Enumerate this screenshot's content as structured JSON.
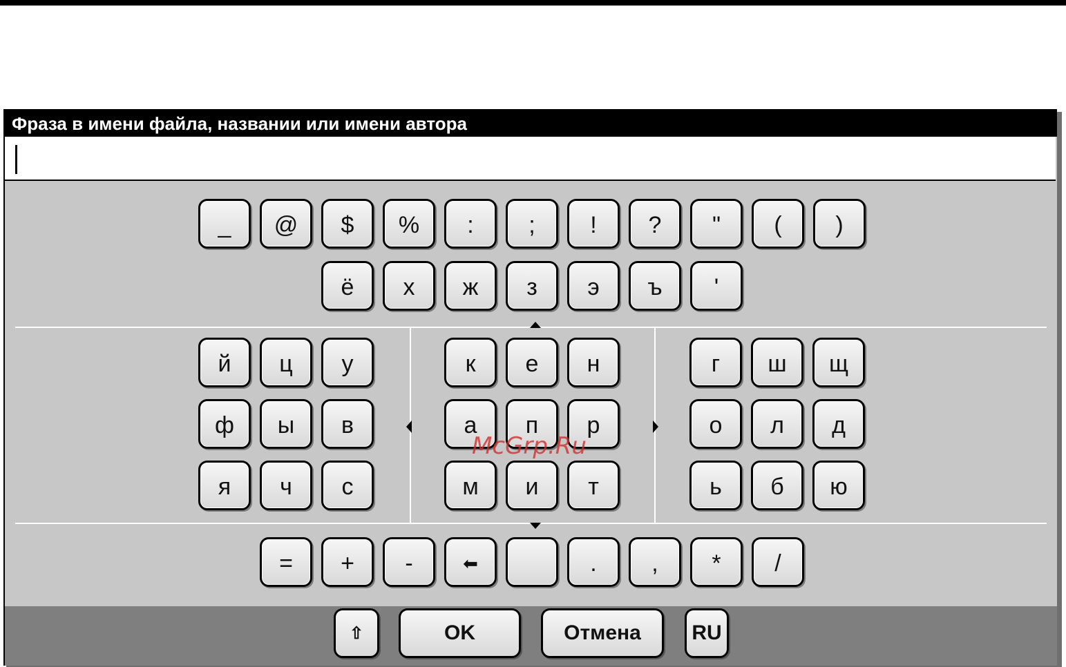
{
  "dialog": {
    "title": "Фраза в имени файла, названии или имени автора",
    "input_value": ""
  },
  "keyboard": {
    "symbols_row": [
      "_",
      "@",
      "$",
      "%",
      ":",
      ";",
      "!",
      "?",
      "\"",
      "(",
      ")"
    ],
    "extra_letters_row": [
      "ё",
      "х",
      "ж",
      "з",
      "э",
      "ъ",
      "'"
    ],
    "left_block": [
      [
        "й",
        "ц",
        "у"
      ],
      [
        "ф",
        "ы",
        "в"
      ],
      [
        "я",
        "ч",
        "с"
      ]
    ],
    "center_block": [
      [
        "к",
        "е",
        "н"
      ],
      [
        "а",
        "п",
        "р"
      ],
      [
        "м",
        "и",
        "т"
      ]
    ],
    "right_block": [
      [
        "г",
        "ш",
        "щ"
      ],
      [
        "о",
        "л",
        "д"
      ],
      [
        "ь",
        "б",
        "ю"
      ]
    ],
    "bottom_row": [
      "=",
      "+",
      "-",
      "⬅",
      " ",
      ".",
      ",",
      "*",
      "/"
    ]
  },
  "buttons": {
    "shift_icon": "⇧",
    "ok_label": "OK",
    "cancel_label": "Отмена",
    "language_label": "RU"
  },
  "watermark": "McGrp.Ru"
}
